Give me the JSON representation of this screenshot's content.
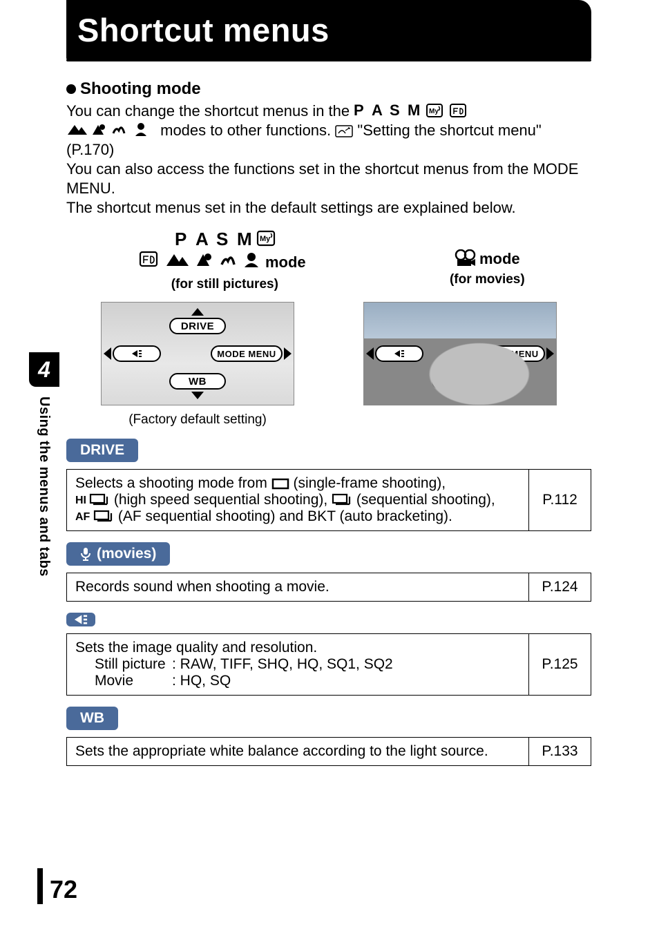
{
  "chapter_title": "Shortcut menus",
  "subhead": "Shooting mode",
  "intro_line1": "You can change the shortcut menus in the ",
  "intro_line2a": " modes to other functions. ",
  "intro_line2b": " \"Setting the shortcut menu\" (P.170)",
  "intro_line3": "You can also access the functions set in the shortcut menus from the MODE MENU.",
  "intro_line4": "The shortcut menus set in the default settings are explained below.",
  "col_still": {
    "mode_word": "mode",
    "sub": "(for still pictures)"
  },
  "col_movie": {
    "mode_word": " mode",
    "sub": "(for movies)"
  },
  "diagram": {
    "top_still": "DRIVE",
    "right": "MODE MENU",
    "bottom": "WB",
    "caption_still": "(Factory default setting)"
  },
  "sections": {
    "drive": {
      "label": "DRIVE",
      "text_a": "Selects a shooting mode from ",
      "text_b": " (single-frame shooting), ",
      "text_c": " (high speed sequential shooting), ",
      "text_d": " (sequential shooting), ",
      "text_e": " (AF sequential shooting) and BKT (auto bracketing).",
      "ref": "P.112"
    },
    "movies": {
      "label": " (movies)",
      "text": "Records sound when shooting a movie.",
      "ref": "P.124"
    },
    "quality": {
      "l1": "Sets the image quality and resolution.",
      "l2a": "Still picture",
      "l2b": ": RAW, TIFF, SHQ, HQ, SQ1, SQ2",
      "l3a": "Movie",
      "l3b": ": HQ, SQ",
      "ref": "P.125"
    },
    "wb": {
      "label": "WB",
      "text": "Sets the appropriate white balance according to the light source.",
      "ref": "P.133"
    }
  },
  "side": {
    "num": "4",
    "text": "Using the menus and tabs"
  },
  "pagenum": "72"
}
